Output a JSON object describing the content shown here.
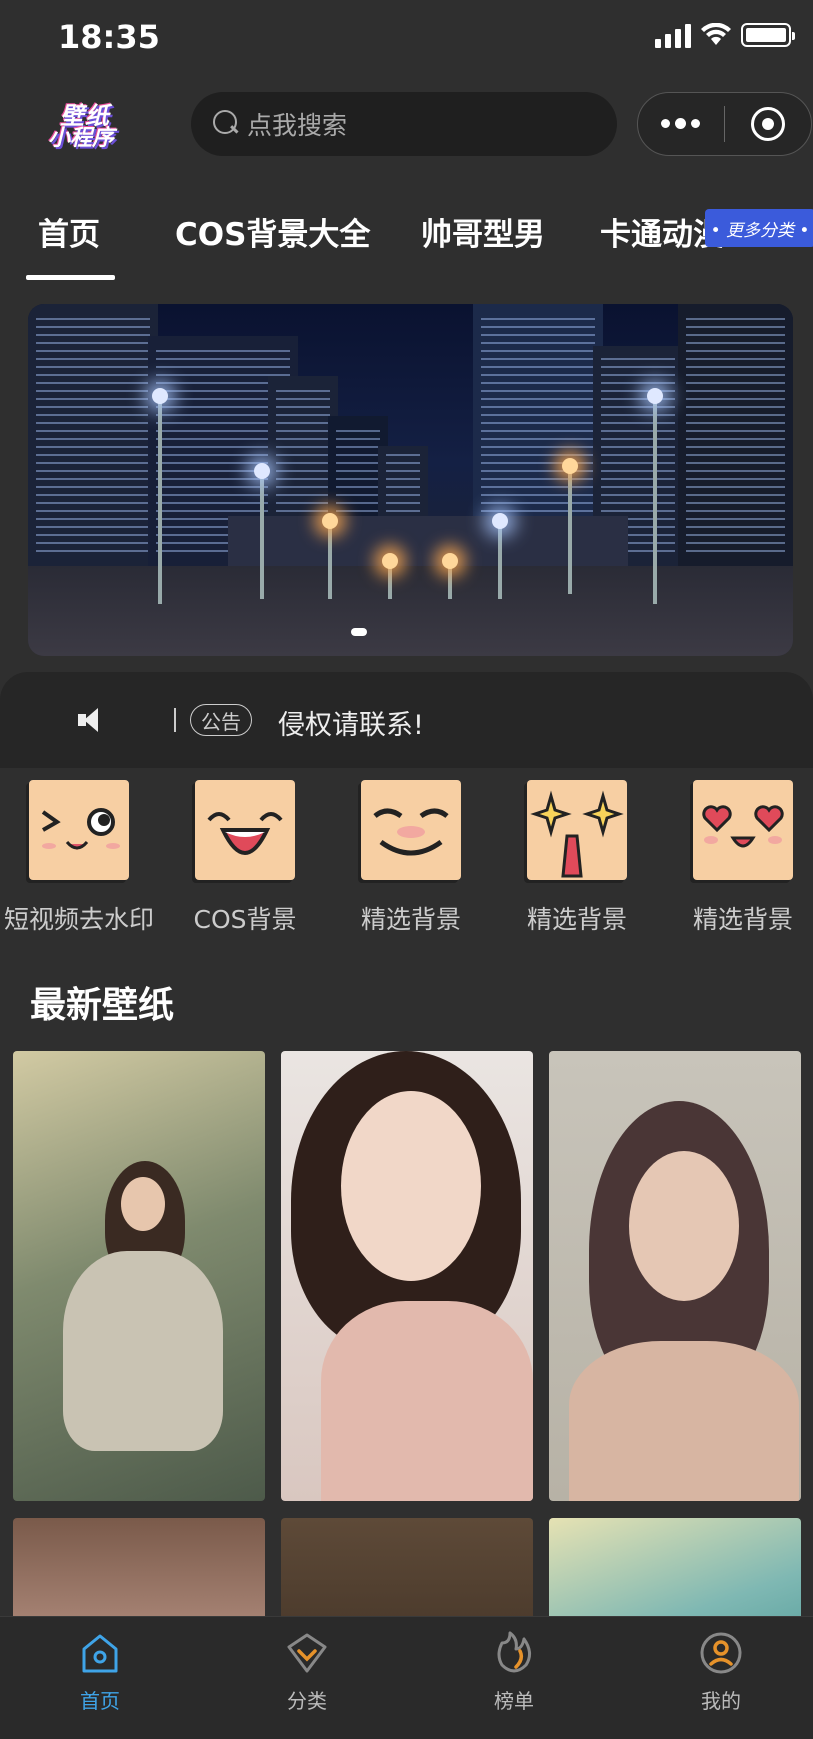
{
  "status_bar": {
    "time": "18:35"
  },
  "header": {
    "logo_line1": "壁纸",
    "logo_line2": "小程序",
    "search_placeholder": "点我搜索"
  },
  "tabs": [
    {
      "label": "首页",
      "active": true
    },
    {
      "label": "COS背景大全"
    },
    {
      "label": "帅哥型男"
    },
    {
      "label": "卡通动漫"
    }
  ],
  "more_categories_label": "• 更多分类 •",
  "notice": {
    "badge": "公告",
    "text": "侵权请联系!"
  },
  "categories": [
    {
      "label": "短视频去水印",
      "icon": "wink-face-icon"
    },
    {
      "label": "COS背景",
      "icon": "laughing-face-icon"
    },
    {
      "label": "精选背景",
      "icon": "grin-face-icon"
    },
    {
      "label": "精选背景",
      "icon": "starry-eyes-face-icon"
    },
    {
      "label": "精选背景",
      "icon": "heart-eyes-face-icon"
    }
  ],
  "section_title": "最新壁纸",
  "tabbar": [
    {
      "label": "首页",
      "icon": "home-icon",
      "active": true
    },
    {
      "label": "分类",
      "icon": "category-icon"
    },
    {
      "label": "榜单",
      "icon": "ranking-icon"
    },
    {
      "label": "我的",
      "icon": "profile-icon"
    }
  ],
  "colors": {
    "background": "#2f2f2f",
    "accent_blue": "#3fa4e8",
    "more_badge": "#3b5bdb",
    "tabbar_orange": "#e6922a"
  }
}
